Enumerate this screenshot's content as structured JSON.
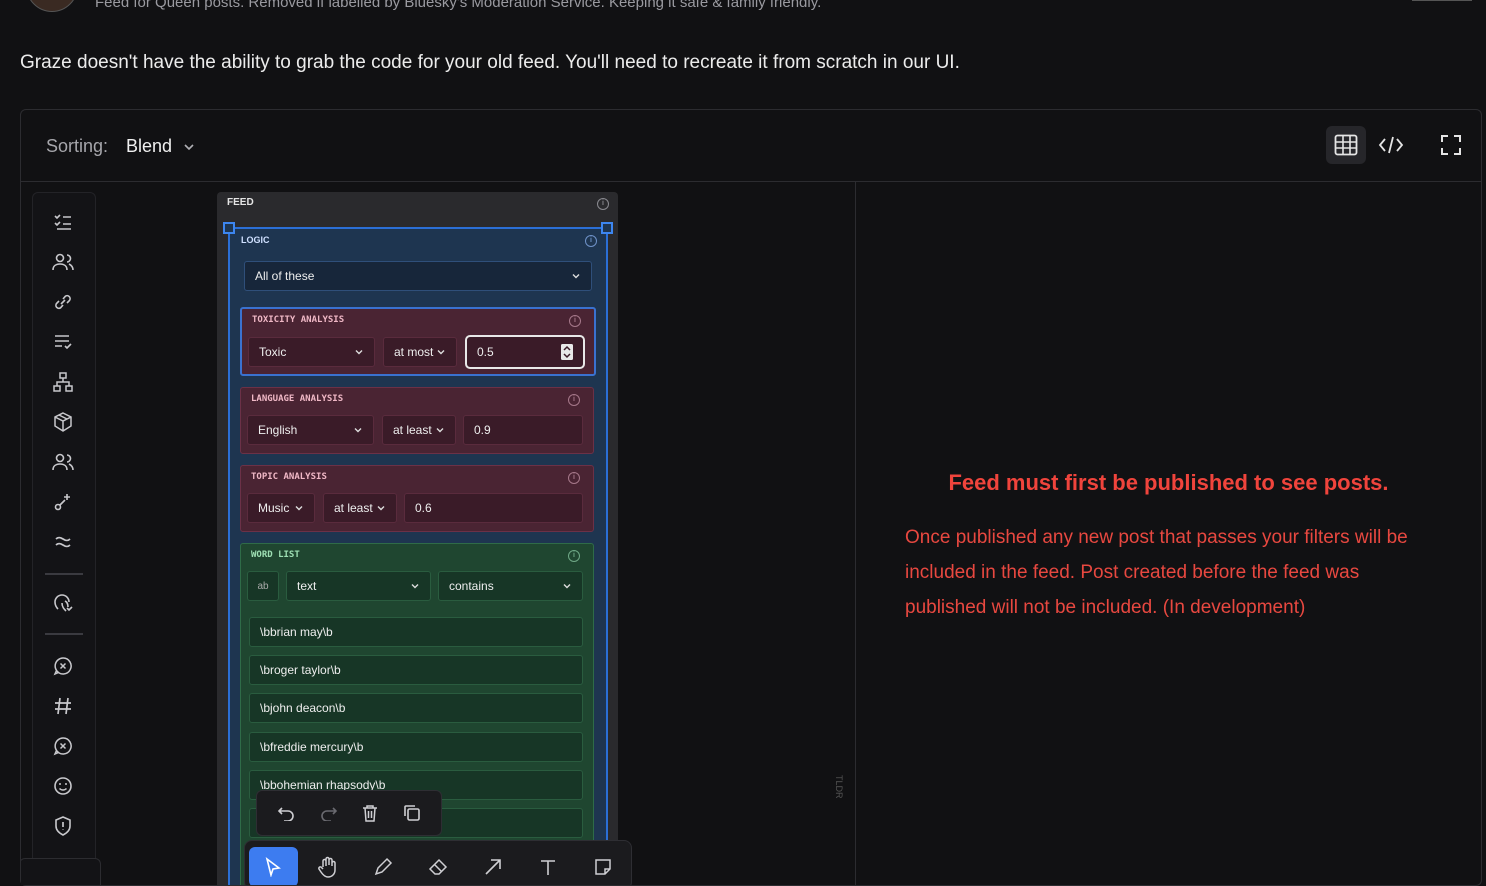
{
  "header": {
    "feed_description": "Feed for Queen posts. Removed if labelled by Bluesky's Moderation Service. Keeping it safe & family friendly."
  },
  "notice": "Graze doesn't have the ability to grab the code for your old feed. You'll need to recreate it from scratch in our UI.",
  "toolbar": {
    "sorting_label": "Sorting:",
    "sorting_value": "Blend"
  },
  "feed": {
    "title": "FEED",
    "logic": {
      "title": "LOGIC",
      "mode": "All of these",
      "blocks": {
        "toxicity": {
          "title": "TOXICITY ANALYSIS",
          "category": "Toxic",
          "operator": "at most",
          "value": "0.5"
        },
        "language": {
          "title": "LANGUAGE ANALYSIS",
          "category": "English",
          "operator": "at least",
          "value": "0.9"
        },
        "topic": {
          "title": "TOPIC ANALYSIS",
          "category": "Music",
          "operator": "at least",
          "value": "0.6"
        },
        "word_list": {
          "title": "WORD LIST",
          "mode_badge": "ab",
          "field": "text",
          "operator": "contains",
          "words": [
            "\\bbrian may\\b",
            "\\broger taylor\\b",
            "\\bjohn deacon\\b",
            "\\bfreddie mercury\\b",
            "\\bbohemian rhapsody\\b"
          ]
        }
      }
    }
  },
  "preview": {
    "title": "Feed must first be published to see posts.",
    "body": "Once published any new post that passes your filters will be included in the feed. Post created before the feed was published will not be included. (In development)"
  },
  "canvas": {
    "watermark": "TLDR"
  },
  "colors": {
    "accent": "#3d7cf0",
    "warning": "#e84840"
  }
}
